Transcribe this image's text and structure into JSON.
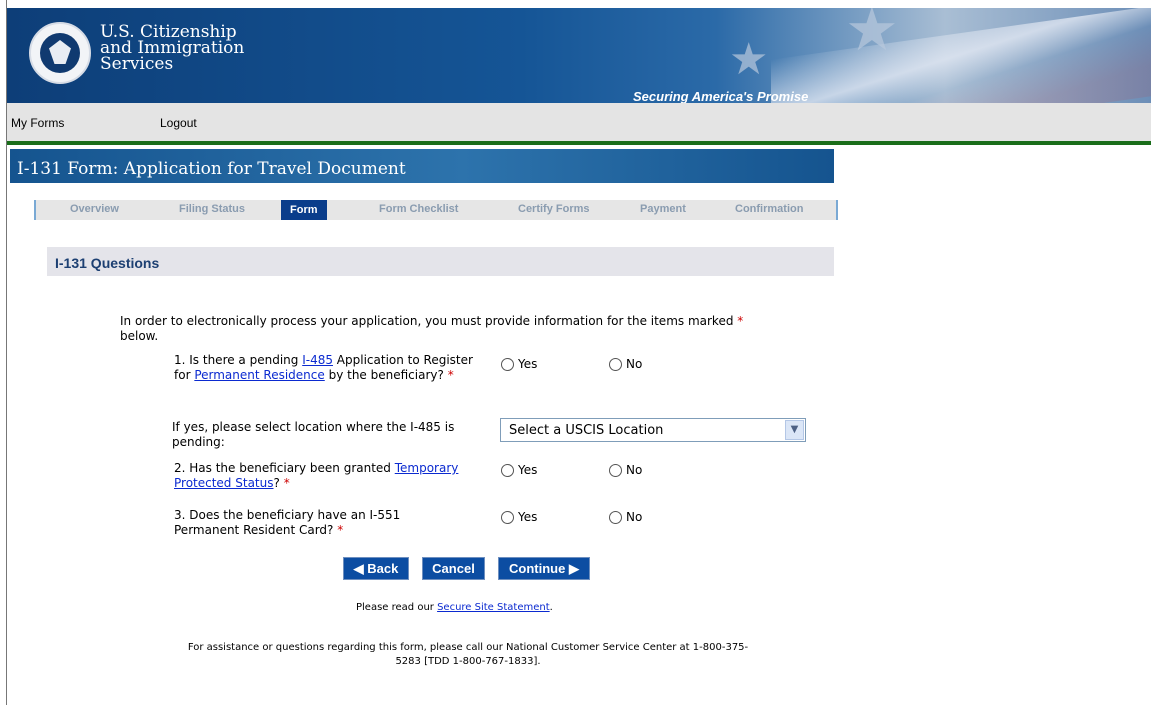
{
  "header": {
    "agency_line1": "U.S. Citizenship",
    "agency_line2": "and Immigration",
    "agency_line3": "Services",
    "tagline": "Securing America's Promise"
  },
  "nav": {
    "my_forms": "My Forms",
    "logout": "Logout"
  },
  "form": {
    "title": "I-131 Form: Application for Travel Document",
    "tabs": [
      "Overview",
      "Filing Status",
      "Form",
      "Form Checklist",
      "Certify Forms",
      "Payment",
      "Confirmation"
    ],
    "active_tab": "Form"
  },
  "section": {
    "title": "I-131 Questions"
  },
  "intro": {
    "text_a": "In order to electronically process your application, you must provide information for the items marked",
    "asterisk": "*",
    "text_b": "below."
  },
  "questions": {
    "q1": {
      "prefix": "1. Is there a pending ",
      "link1": "I-485",
      "mid": " Application to Register for ",
      "link2": "Permanent Residence",
      "suffix": " by the beneficiary?"
    },
    "location": {
      "label": "If yes, please select location where the I-485 is pending:",
      "select_value": "Select a USCIS Location"
    },
    "q2": {
      "prefix": "2. Has the beneficiary been granted ",
      "link": "Temporary Protected Status",
      "suffix": "?"
    },
    "q3": {
      "text": "3. Does the beneficiary have an I-551 Permanent Resident Card?"
    },
    "yes": "Yes",
    "no": "No",
    "asterisk": "*"
  },
  "buttons": {
    "back": "◀ Back",
    "cancel": "Cancel",
    "continue": "Continue ▶"
  },
  "footer": {
    "secure_prefix": "Please read our ",
    "secure_link": "Secure Site Statement",
    "secure_suffix": ".",
    "assistance": "For assistance or questions regarding this form, please call our National Customer Service Center at 1-800-375-5283 [TDD 1-800-767-1833]."
  }
}
